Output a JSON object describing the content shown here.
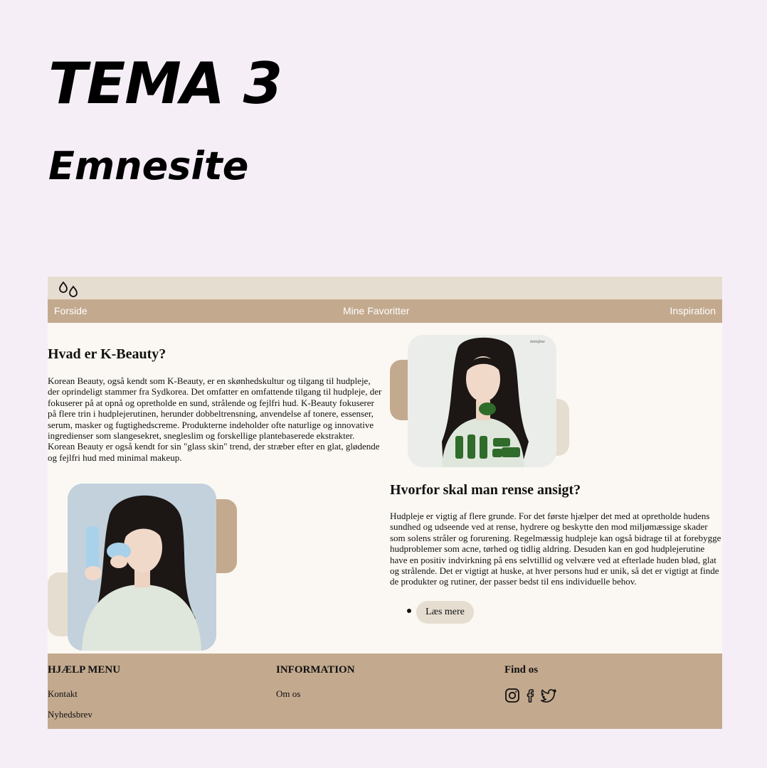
{
  "slide": {
    "title": "TEMA 3",
    "subtitle": "Emnesite"
  },
  "site": {
    "logo_icon": "water-drops-icon",
    "nav": {
      "home": "Forside",
      "favorites": "Mine Favoritter",
      "inspiration": "Inspiration"
    },
    "section1": {
      "heading": "Hvad er K-Beauty?",
      "body": "Korean Beauty, også kendt som K-Beauty, er en skønhedskultur og tilgang til hudpleje, der oprindeligt stammer fra Sydkorea. Det omfatter en omfattende tilgang til hudpleje, der fokuserer på at opnå og opretholde en sund, strålende og fejlfri hud. K-Beauty fokuserer på flere trin i hudplejerutinen, herunder dobbeltrensning, anvendelse af tonere, essenser, serum, masker og fugtighedscreme. Produkterne indeholder ofte naturlige og innovative ingredienser som slangesekret, snegleslim og forskellige plantebaserede ekstrakter. Korean Beauty er også kendt for sin \"glass skin\" trend, der stræber efter en glat, glødende og fejlfri hud med minimal makeup."
    },
    "product_photo": {
      "brand_text": "innisfree"
    },
    "section2": {
      "heading": "Hvorfor skal man rense ansigt?",
      "body": "Hudpleje er vigtig af flere grunde. For det første hjælper det med at opretholde hudens sundhed og udseende ved at rense, hydrere og beskytte den mod miljømæssige skader som solens stråler og forurening. Regelmæssig hudpleje kan også bidrage til at forebygge hudproblemer som acne, tørhed og tidlig aldring. Desuden kan en god hudplejerutine have en positiv indvirkning på ens selvtillid og velvære ved at efterlade huden blød, glat og strålende. Det er vigtigt at huske, at hver persons hud er unik, så det er vigtigt at finde de produkter og rutiner, der passer bedst til ens individuelle behov.",
      "button": "Læs mere"
    },
    "footer": {
      "col1": {
        "heading": "HJÆLP MENU",
        "links": [
          "Kontakt",
          "Nyhedsbrev"
        ]
      },
      "col2": {
        "heading": "INFORMATION",
        "links": [
          "Om os"
        ]
      },
      "col3": {
        "heading": "Find os",
        "icons": [
          "instagram-icon",
          "facebook-icon",
          "twitter-icon"
        ]
      }
    },
    "colors": {
      "page_bg": "#f6eef7",
      "site_bg": "#fbf8f3",
      "beige_light": "#e6ddd1",
      "beige_dark": "#c3a98e"
    }
  }
}
